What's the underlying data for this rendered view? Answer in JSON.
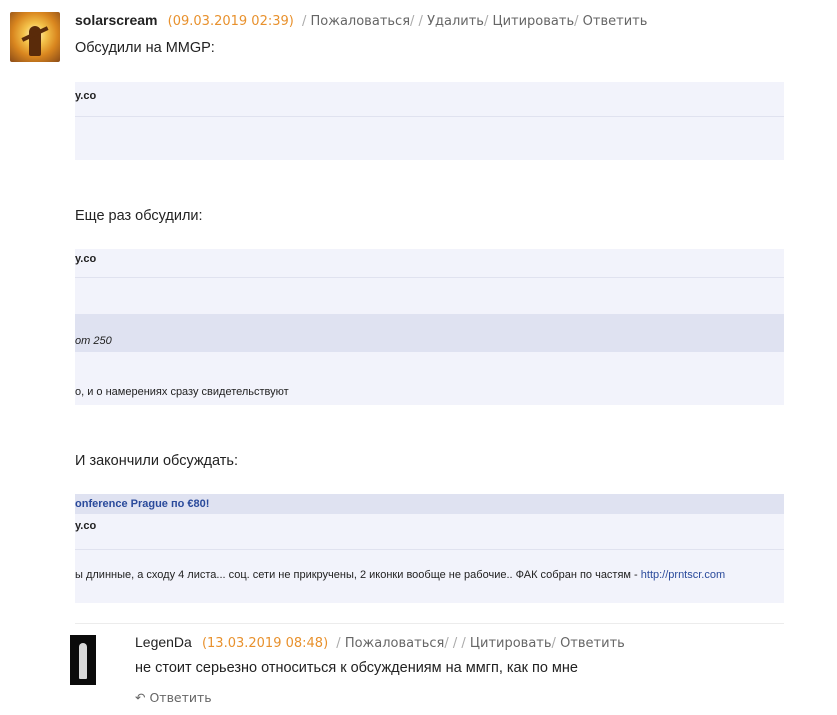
{
  "post1": {
    "author": "solarscream",
    "date": "(09.03.2019 02:39)",
    "actions": {
      "complain": "Пожаловаться",
      "sep1": "/",
      "sep2": "/",
      "delete": "Удалить",
      "cite": "Цитировать",
      "sep3": "/",
      "reply": "Ответить"
    },
    "text1": "Обсудили на MMGP:",
    "text2": "Еще раз обсудили:",
    "text3": "И закончили обсуждать:",
    "shot1": {
      "r1": "y.co"
    },
    "shot2": {
      "r1": "y.co",
      "r2": "от 250",
      "r3": "о, и о намерениях сразу свидетельствуют"
    },
    "shot3": {
      "r1": "onference Prague по €80!",
      "r2": "y.co",
      "r3": "ы длинные, а сходу 4 листа... соц. сети не прикручены, 2 иконки вообще не рабочие.. ФАК собран по частям - ",
      "link": "http://prntscr.com"
    }
  },
  "post2": {
    "author": "LegenDa",
    "date": "(13.03.2019 08:48)",
    "actions": {
      "complain": "Пожаловаться",
      "sep1": "/",
      "sep2": "/",
      "cite": "Цитировать",
      "sep3": "/",
      "reply": "Ответить"
    },
    "text": "не стоит серьезно относиться к обсуждениям на ммгп, как по мне",
    "answer": "↶ Ответить"
  },
  "colors": {
    "date": "#e8912d",
    "shot_bg": "#f2f3fb",
    "shot_header": "#dfe2f1",
    "link": "#2a4a9b"
  },
  "icons": [
    "reply-arrow-icon"
  ]
}
